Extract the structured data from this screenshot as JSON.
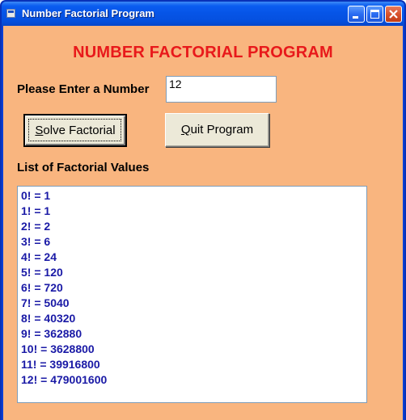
{
  "window": {
    "title": "Number Factorial Program",
    "colors": {
      "titlebar": "#0654e6",
      "client_bg": "#f9b57f",
      "heading": "#e8191b",
      "list_text": "#1a1aa6"
    }
  },
  "main": {
    "heading": "NUMBER FACTORIAL PROGRAM",
    "prompt_label": "Please Enter a Number",
    "number_input_value": "12",
    "solve_button": {
      "mnemonic": "S",
      "rest": "olve Factorial"
    },
    "quit_button": {
      "mnemonic": "Q",
      "rest": "uit Program"
    },
    "list_label": "List of Factorial Values",
    "list_items": [
      "0! = 1",
      "1! = 1",
      "2! = 2",
      "3! = 6",
      "4! = 24",
      "5! = 120",
      "6! = 720",
      "7! = 5040",
      "8! = 40320",
      "9! = 362880",
      "10! = 3628800",
      "11! = 39916800",
      "12! = 479001600"
    ]
  },
  "icons": {
    "app": "app-window-icon",
    "minimize": "minimize-icon",
    "maximize": "maximize-icon",
    "close": "close-icon"
  }
}
